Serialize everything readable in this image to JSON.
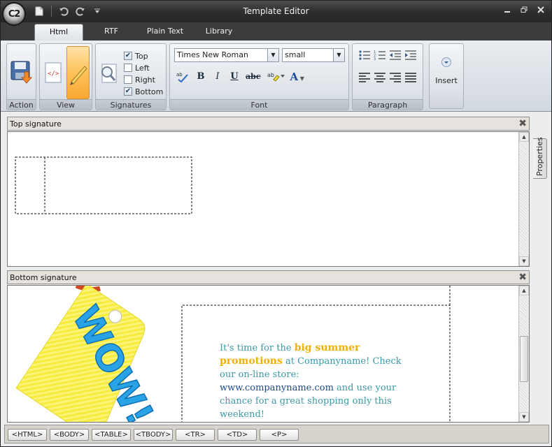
{
  "window": {
    "title": "Template Editor",
    "logo": "C2"
  },
  "quick_access": [
    "new-document-icon",
    "undo-icon",
    "redo-icon",
    "customize-dropdown-icon"
  ],
  "tabs": [
    {
      "label": "Html",
      "active": true
    },
    {
      "label": "RTF",
      "active": false
    },
    {
      "label": "Plain Text",
      "active": false
    },
    {
      "label": "Library",
      "active": false
    }
  ],
  "ribbon": {
    "action": {
      "label": "Action",
      "button_icon": "save-icon"
    },
    "view": {
      "label": "View",
      "buttons": [
        "html-source-icon",
        "design-pencil-icon"
      ]
    },
    "signatures": {
      "label": "Signatures",
      "options": [
        {
          "label": "Top",
          "checked": true
        },
        {
          "label": "Left",
          "checked": false
        },
        {
          "label": "Right",
          "checked": false
        },
        {
          "label": "Bottom",
          "checked": true
        }
      ]
    },
    "font": {
      "label": "Font",
      "family": "Times New Roman",
      "size": "small",
      "bold": "B",
      "italic": "I",
      "underline": "U",
      "strike": "abc",
      "color_letter": "A"
    },
    "paragraph": {
      "label": "Paragraph"
    },
    "insert": {
      "label": "Insert"
    }
  },
  "top_pane": {
    "title": "Top signature"
  },
  "bottom_pane": {
    "title": "Bottom signature",
    "tag_text": "WOW!",
    "promo": {
      "p1": "It's time for the ",
      "hl1": "big summer promotions",
      "p2": " at Companyname! Check our on-line store: ",
      "url": "www.companyname.com",
      "p3": " and use your chance for a great shopping only this weekend!"
    }
  },
  "properties_tab": "Properties",
  "breadcrumbs": [
    "<HTML>",
    "<BODY>",
    "<TABLE>",
    "<TBODY>",
    "<TR>",
    "<TD>",
    "<P>"
  ],
  "colors": {
    "accent_orange": "#ffc25a",
    "promo_teal": "#3a9aa7",
    "promo_highlight": "#f0b000",
    "tag_yellow": "#f5e838",
    "tag_text_blue": "#2aa3e6"
  }
}
